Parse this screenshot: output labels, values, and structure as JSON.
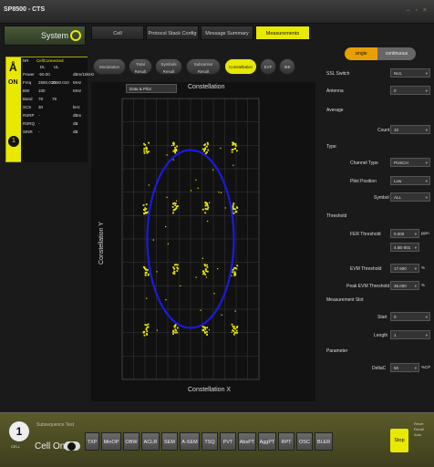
{
  "app": {
    "title": "SP8500 - CTS"
  },
  "system": {
    "label": "System"
  },
  "status": {
    "on": "ON",
    "cell_number": "1",
    "header": [
      "NR",
      "CellConnected"
    ],
    "subheader": [
      "DL",
      "UL"
    ],
    "rows": [
      {
        "k": "Power",
        "v1": "-50.00",
        "v2": "",
        "u": "dBm/15kHz"
      },
      {
        "k": "Freq",
        "v1": "2550.010",
        "v2": "2550.010",
        "u": "MHz"
      },
      {
        "k": "BW",
        "v1": "100",
        "v2": "",
        "u": "MHz"
      },
      {
        "k": "Band",
        "v1": "78",
        "v2": "78",
        "u": ""
      },
      {
        "k": "SCS",
        "v1": "30",
        "v2": "",
        "u": "kHz"
      },
      {
        "k": "RSRP",
        "v1": "-",
        "v2": "",
        "u": "dBm"
      },
      {
        "k": "RSRQ",
        "v1": "-",
        "v2": "",
        "u": "dB"
      },
      {
        "k": "SINR",
        "v1": "-",
        "v2": "",
        "u": "dB"
      }
    ]
  },
  "tabs": [
    "Cell",
    "Protocol Stack Config",
    "Message Summary",
    "Measurements"
  ],
  "subtabs": [
    {
      "label": "Modulation",
      "line2": ""
    },
    {
      "label": "Total",
      "line2": "Result"
    },
    {
      "label": "Symbols",
      "line2": "Result"
    },
    {
      "label": "Subcarrier",
      "line2": "Result"
    },
    {
      "label": "Constellation",
      "line2": ""
    },
    {
      "label": "EVF",
      "line2": ""
    },
    {
      "label": "IBE",
      "line2": ""
    }
  ],
  "plot": {
    "dropdown": "Data & Pilot",
    "title": "Constellation",
    "xlabel": "Constellation X",
    "ylabel": "Constellation Y"
  },
  "chart_data": {
    "type": "scatter",
    "title": "Constellation",
    "xlabel": "Constellation X",
    "ylabel": "Constellation Y",
    "xlim": [
      -1.5,
      1.5
    ],
    "ylim": [
      -1.5,
      1.5
    ],
    "grid": true,
    "points_color": "#e8e800",
    "circle_color": "#1a1ae0",
    "circle_radius": 0.95,
    "clusters": [
      [
        -0.97,
        0.97
      ],
      [
        -0.33,
        0.97
      ],
      [
        0.33,
        0.97
      ],
      [
        0.97,
        0.97
      ],
      [
        -0.97,
        0.33
      ],
      [
        -0.33,
        0.33
      ],
      [
        0.33,
        0.33
      ],
      [
        0.97,
        0.33
      ],
      [
        -0.97,
        -0.33
      ],
      [
        -0.33,
        -0.33
      ],
      [
        0.33,
        -0.33
      ],
      [
        0.97,
        -0.33
      ],
      [
        -0.97,
        -0.97
      ],
      [
        -0.33,
        -0.97
      ],
      [
        0.33,
        -0.97
      ],
      [
        0.97,
        -0.97
      ]
    ]
  },
  "right": {
    "mode_single": "single",
    "mode_continuous": "continuous",
    "ssl_switch": {
      "label": "SSL Switch",
      "value": "NUL"
    },
    "antenna": {
      "label": "Antenna",
      "value": "0"
    },
    "average": {
      "label": "Average"
    },
    "count": {
      "label": "Count",
      "value": "10"
    },
    "type": {
      "label": "Type"
    },
    "channel_type": {
      "label": "Channel Type",
      "value": "PUSCH"
    },
    "pilot_position": {
      "label": "Pilot Position",
      "value": "Low"
    },
    "symbol": {
      "label": "Symbol",
      "value": "ALL"
    },
    "threshold": {
      "label": "Threshold"
    },
    "fer_threshold": {
      "label": "FER Threshold",
      "value": "0.000",
      "unit": "ppm",
      "value2": "4.5E-001"
    },
    "evm_threshold": {
      "label": "EVM Threshold",
      "value": "17.500",
      "unit": "%"
    },
    "peak_evm_threshold": {
      "label": "Peak EVM Threshold",
      "value": "35.000",
      "unit": "%"
    },
    "measurement_slot": {
      "label": "Measurement Slot"
    },
    "start": {
      "label": "Start",
      "value": "0"
    },
    "length": {
      "label": "Length",
      "value": "1"
    },
    "parameter": {
      "label": "Parameter"
    },
    "deltac": {
      "label": "DeltaC",
      "value": "50",
      "unit": "%CP"
    }
  },
  "bottom": {
    "cell": "1",
    "cell_sub": "CELL",
    "sub_label": "Subsequence Test",
    "cell_on": "Cell On",
    "buttons": [
      "TXP",
      "MinOP",
      "OBW",
      "ACLR",
      "SEM",
      "A-SEM",
      "TSQ",
      "PVT",
      "AbsPT",
      "AggPT",
      "RPT",
      "OSC",
      "BLER"
    ],
    "stop": "Stop",
    "side": [
      "Reset",
      "Recall",
      "Auto"
    ]
  },
  "colors": {
    "accent": "#e8e800",
    "circle": "#1a1ae0",
    "orange": "#e8a000"
  }
}
